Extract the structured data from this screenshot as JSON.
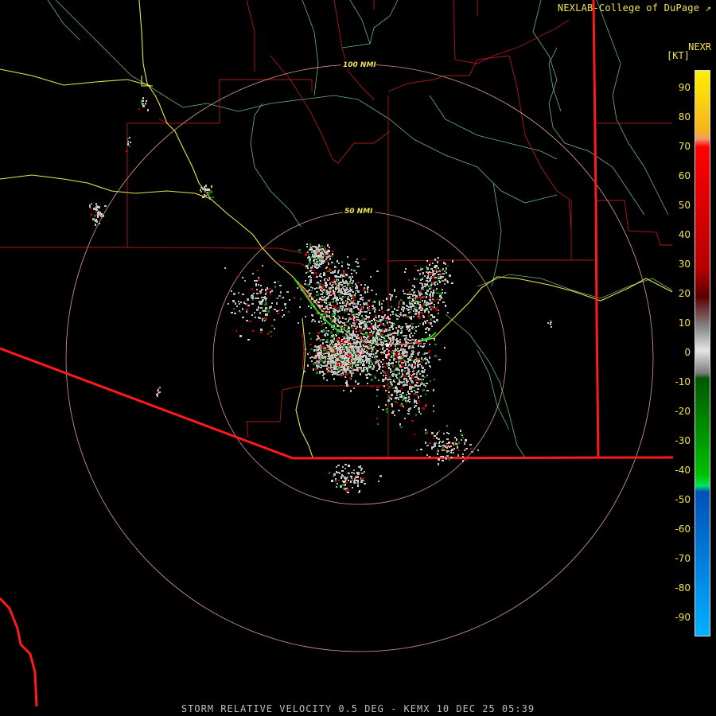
{
  "header": {
    "credit": "NEXLAB-College of DuPage",
    "credit_mark": "↗"
  },
  "legend": {
    "product": "NEXR",
    "unit": "[KT]",
    "ticks": [
      "90",
      "80",
      "70",
      "60",
      "50",
      "40",
      "30",
      "20",
      "10",
      "0",
      "-10",
      "-20",
      "-30",
      "-40",
      "-50",
      "-60",
      "-70",
      "-80",
      "-90"
    ]
  },
  "rings": {
    "inner_label": "50 NMI",
    "outer_label": "100 NMI"
  },
  "footer": {
    "title": "STORM RELATIVE VELOCITY 0.5 DEG - KEMX 10 DEC 25 05:39"
  },
  "colors": {
    "background": "#000000",
    "county_lines": "#b01818",
    "state_border": "#ff1a1a",
    "interstate": "#e8e84a",
    "rivers": "#7bd59a",
    "rings": "#d9a08c",
    "clutter_echo": "#c0c0c0",
    "inbound_velocity": "#00c000",
    "outbound_velocity": "#c00000"
  }
}
